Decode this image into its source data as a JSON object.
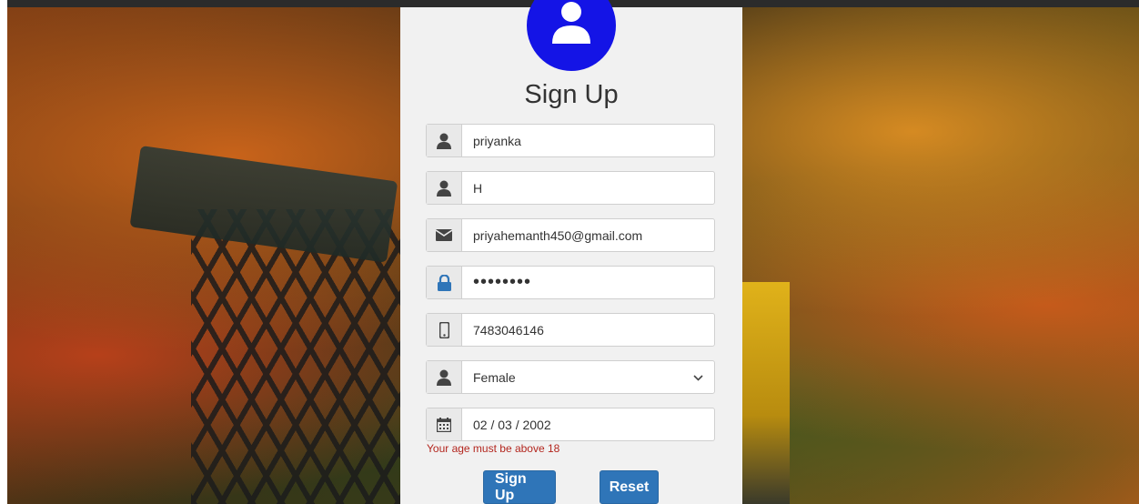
{
  "form": {
    "title": "Sign Up",
    "first_name": "priyanka",
    "last_name": "H",
    "email": "priyahemanth450@gmail.com",
    "password": "••••••••",
    "phone": "7483046146",
    "gender": "Female",
    "dob": "02 / 03 / 2002",
    "error": "Your age must be above 18",
    "signup_label": "Sign Up",
    "reset_label": "Reset"
  },
  "colors": {
    "avatar": "#1414e6",
    "button": "#2f75b8",
    "error": "#b3261e",
    "lock_icon": "#2f75b8"
  },
  "icons": [
    "user-icon",
    "envelope-icon",
    "lock-icon",
    "mobile-icon",
    "calendar-icon",
    "chevron-down-icon"
  ]
}
